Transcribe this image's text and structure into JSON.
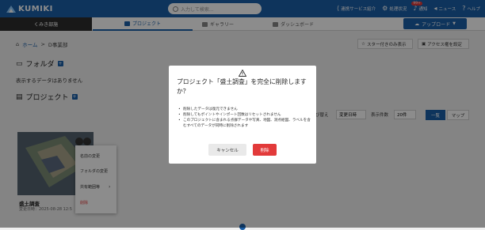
{
  "app": {
    "logo_text": "KUMIKI"
  },
  "search": {
    "placeholder": "入力して検索..."
  },
  "top_nav": {
    "items": [
      {
        "label": "連携サービス紹介",
        "icon": "share-icon"
      },
      {
        "label": "処理状況",
        "icon": "gear-icon"
      },
      {
        "label": "通知",
        "icon": "bell-icon",
        "badge": "99+"
      },
      {
        "label": "ニュース",
        "icon": "megaphone-icon"
      },
      {
        "label": "ヘルプ",
        "icon": "help-icon"
      }
    ]
  },
  "org": {
    "name": "くみき部施"
  },
  "tabs": [
    {
      "label": "プロジェクト",
      "icon": "folder-icon",
      "active": true
    },
    {
      "label": "ギャラリー",
      "icon": "image-icon",
      "active": false
    },
    {
      "label": "ダッシュボード",
      "icon": "monitor-icon",
      "active": false
    }
  ],
  "upload": {
    "label": "アップロード",
    "icon": "cloud-upload-icon"
  },
  "breadcrumb": {
    "home": "ホーム",
    "separator": ">",
    "current": "D事業部"
  },
  "actions": {
    "starred": "スター付きのみ表示",
    "access": "アクセス権を設定"
  },
  "folders": {
    "title": "フォルダ",
    "empty": "表示するデータはありません"
  },
  "projects": {
    "title": "プロジェクト"
  },
  "toolbar": {
    "sort_label": "び替え",
    "sort_value": "変更日時",
    "count_label": "表示件数",
    "count_value": "20件",
    "view_list": "一覧",
    "view_map": "マップ"
  },
  "card": {
    "name": "盛土調査",
    "date": "変更日時：2025-08-28 12:5"
  },
  "context_menu": {
    "items": [
      "名前の変更",
      "フォルダの変更",
      "共有範囲等",
      "削除"
    ]
  },
  "modal": {
    "title": "プロジェクト「盛土調査」を完全に削除しますか？",
    "bullets": [
      "削除したデータは復元できません",
      "削除してもポイントやインポート回数はリセットされません",
      "このプロジェクトに含まれる点群データや写真、地図、測点絵図、ラベルを含むすべてのデータが同時に削除されます"
    ],
    "cancel": "キャンセル",
    "delete": "削除"
  },
  "colors": {
    "primary": "#1a5fa8",
    "danger": "#e23a3a",
    "header_dark": "#2d2d2d"
  }
}
